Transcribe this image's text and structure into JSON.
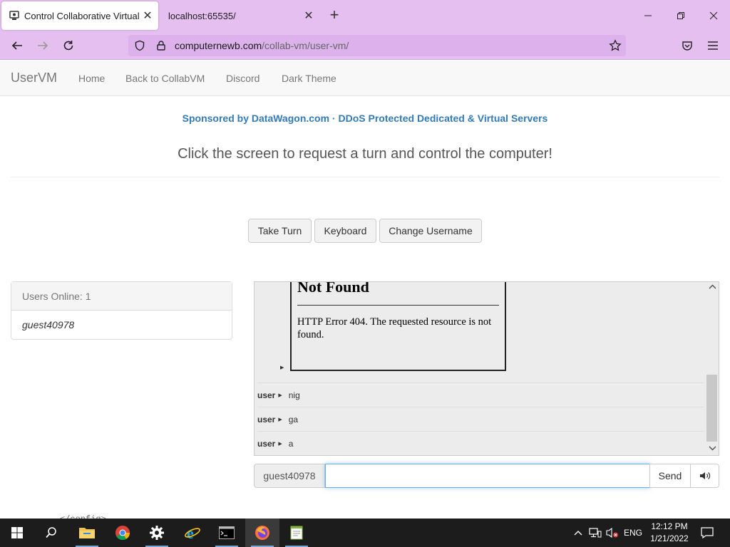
{
  "browser": {
    "tabs": [
      {
        "title": "Control Collaborative Virtual M",
        "active": true
      },
      {
        "title": "localhost:65535/",
        "active": false
      }
    ],
    "url_host": "computernewb.com",
    "url_path": "/collab-vm/user-vm/"
  },
  "site_nav": {
    "brand": "UserVM",
    "links": [
      "Home",
      "Back to CollabVM",
      "Discord",
      "Dark Theme"
    ]
  },
  "sponsor": "Sponsored by DataWagon.com · DDoS Protected Dedicated & Virtual Servers",
  "lead": "Click the screen to request a turn and control the computer!",
  "buttons": {
    "take_turn": "Take Turn",
    "keyboard": "Keyboard",
    "change_username": "Change Username"
  },
  "users": {
    "header": "Users Online: 1",
    "list": [
      "guest40978"
    ]
  },
  "chat": {
    "embedded_page": {
      "title": "Not Found",
      "message": "HTTP Error 404. The requested resource is not found."
    },
    "messages": [
      {
        "user": "user",
        "text": "nig"
      },
      {
        "user": "user",
        "text": "ga"
      },
      {
        "user": "user",
        "text": "a"
      }
    ],
    "username": "guest40978",
    "input_value": "",
    "send_label": "Send"
  },
  "taskbar": {
    "ghost_text": "</config>",
    "language": "ENG",
    "time": "12:12 PM",
    "date": "1/21/2022"
  },
  "colors": {
    "browser_chrome": "#e4bff0",
    "link_blue": "#337ab7",
    "taskbar": "#1c1c1c"
  }
}
